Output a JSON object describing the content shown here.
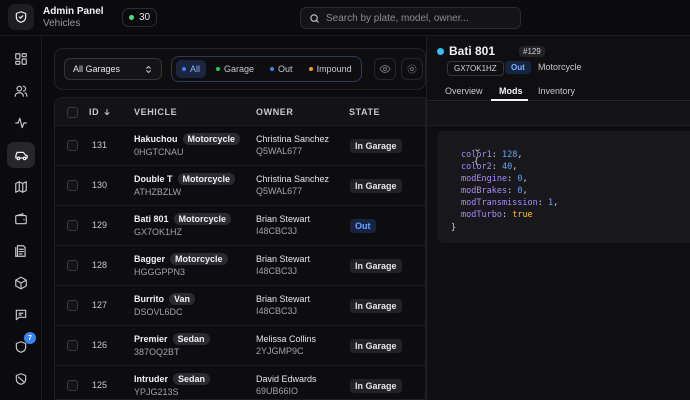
{
  "app": {
    "title": "Admin Panel",
    "subtitle": "Vehicles"
  },
  "online_count": "30",
  "search": {
    "placeholder": "Search by plate, model, owner..."
  },
  "sidebar": {
    "items": [
      {
        "icon": "dashboard-icon"
      },
      {
        "icon": "users-icon"
      },
      {
        "icon": "activity-icon"
      },
      {
        "icon": "car-icon",
        "active": true
      },
      {
        "icon": "map-icon"
      },
      {
        "icon": "wallet-icon"
      },
      {
        "icon": "document-icon"
      },
      {
        "icon": "box-icon"
      },
      {
        "icon": "messages-icon",
        "badge": "7"
      },
      {
        "icon": "shield-icon"
      },
      {
        "icon": "ban-icon"
      }
    ]
  },
  "filters": {
    "garage_select": "All Garages",
    "segments": [
      {
        "label": "All",
        "color": "#3b82f6",
        "active": true
      },
      {
        "label": "Garage",
        "color": "#22c55e"
      },
      {
        "label": "Out",
        "color": "#3b82f6"
      },
      {
        "label": "Impound",
        "color": "#f59e0b"
      }
    ]
  },
  "table": {
    "headers": {
      "id": "ID",
      "vehicle": "VEHICLE",
      "owner": "OWNER",
      "state": "STATE"
    },
    "rows": [
      {
        "id": "131",
        "name": "Hakuchou",
        "type": "Motorcycle",
        "plate": "0HGTCNAU",
        "owner": "Christina Sanchez",
        "owner_id": "Q5WAL677",
        "state": "In Garage"
      },
      {
        "id": "130",
        "name": "Double T",
        "type": "Motorcycle",
        "plate": "ATHZBZLW",
        "owner": "Christina Sanchez",
        "owner_id": "Q5WAL677",
        "state": "In Garage"
      },
      {
        "id": "129",
        "name": "Bati 801",
        "type": "Motorcycle",
        "plate": "GX7OK1HZ",
        "owner": "Brian Stewart",
        "owner_id": "I48CBC3J",
        "state": "Out"
      },
      {
        "id": "128",
        "name": "Bagger",
        "type": "Motorcycle",
        "plate": "HGGGPPN3",
        "owner": "Brian Stewart",
        "owner_id": "I48CBC3J",
        "state": "In Garage"
      },
      {
        "id": "127",
        "name": "Burrito",
        "type": "Van",
        "plate": "DSOVL6DC",
        "owner": "Brian Stewart",
        "owner_id": "I48CBC3J",
        "state": "In Garage"
      },
      {
        "id": "126",
        "name": "Premier",
        "type": "Sedan",
        "plate": "387OQ2BT",
        "owner": "Melissa Collins",
        "owner_id": "2YJGMP9C",
        "state": "In Garage"
      },
      {
        "id": "125",
        "name": "Intruder",
        "type": "Sedan",
        "plate": "YPJG213S",
        "owner": "David Edwards",
        "owner_id": "69UB66IO",
        "state": "In Garage"
      }
    ]
  },
  "detail": {
    "title": "Bati 801",
    "id": "#129",
    "plate": "GX7OK1HZ",
    "state": "Out",
    "class": "Motorcycle",
    "tabs": [
      "Overview",
      "Mods",
      "Inventory"
    ],
    "active_tab": "Mods",
    "mods": {
      "open": "{",
      "close": "}",
      "lines": [
        {
          "key": "color1",
          "value": "128"
        },
        {
          "key": "color2",
          "value": "40"
        },
        {
          "key": "modEngine",
          "value": "0"
        },
        {
          "key": "modBrakes",
          "value": "0"
        },
        {
          "key": "modTransmission",
          "value": "1"
        },
        {
          "key": "modTurbo",
          "value": "true"
        }
      ]
    }
  }
}
